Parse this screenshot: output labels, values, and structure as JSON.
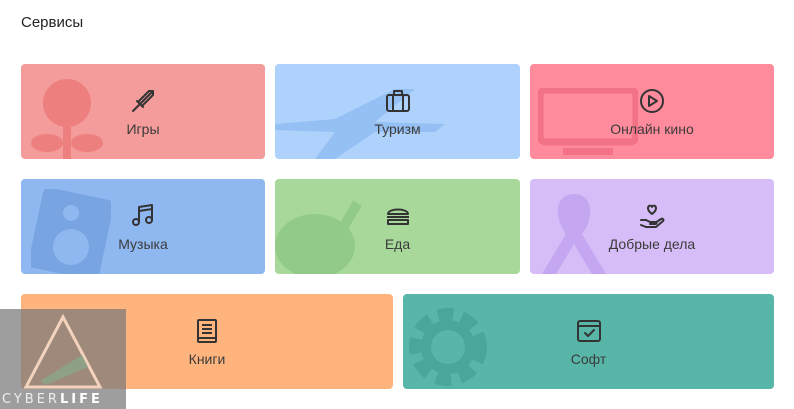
{
  "section": {
    "title": "Сервисы"
  },
  "tiles": [
    {
      "label": "Игры",
      "color": "#f49b9b",
      "icon": "sword-icon"
    },
    {
      "label": "Туризм",
      "color": "#aed2fb",
      "icon": "suitcase-icon"
    },
    {
      "label": "Онлайн кино",
      "color": "#ff8b9c",
      "icon": "play-circle-icon"
    },
    {
      "label": "Музыка",
      "color": "#8fb8f0",
      "icon": "music-note-icon"
    },
    {
      "label": "Еда",
      "color": "#a8d99b",
      "icon": "burger-icon"
    },
    {
      "label": "Добрые дела",
      "color": "#d6bdf8",
      "icon": "heart-hand-icon"
    },
    {
      "label": "Книги",
      "color": "#ffb47e",
      "icon": "book-icon"
    },
    {
      "label": "Софт",
      "color": "#58b6a8",
      "icon": "software-window-icon"
    }
  ],
  "watermark": {
    "brand_light": "CYBER",
    "brand_bold": "LIFE"
  }
}
